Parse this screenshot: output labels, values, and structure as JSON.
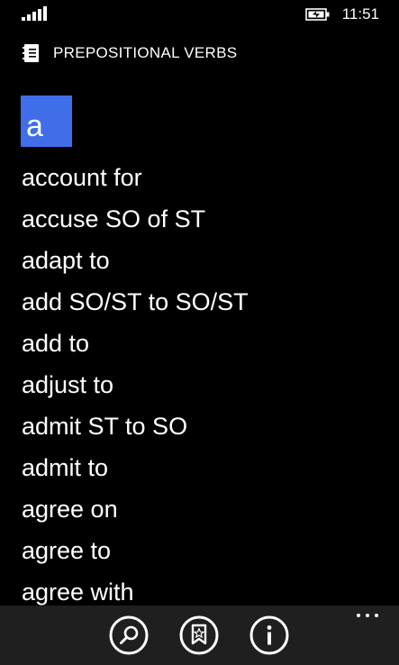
{
  "status_bar": {
    "time": "11:51",
    "icons": [
      "signal-strength-icon",
      "battery-charging-icon"
    ]
  },
  "header": {
    "icon": "notebook-icon",
    "title": "PREPOSITIONAL VERBS"
  },
  "group": {
    "letter": "a",
    "accent_color": "#3f6ee8"
  },
  "verbs": [
    "account for",
    "accuse SO of ST",
    "adapt to",
    "add SO/ST to SO/ST",
    "add to",
    "adjust to",
    "admit ST to SO",
    "admit to",
    "agree on",
    "agree to",
    "agree with"
  ],
  "app_bar": {
    "buttons": [
      "search-icon",
      "bookmark-star-icon",
      "info-icon"
    ],
    "more": "more-options-icon",
    "background": "#1f1f1f"
  }
}
